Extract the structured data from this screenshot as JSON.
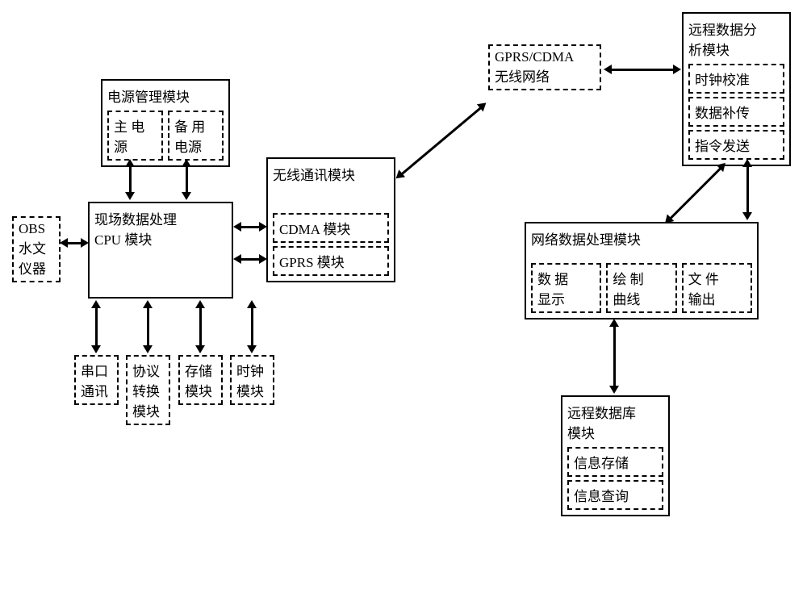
{
  "obs": {
    "l1": "OBS",
    "l2": "水文",
    "l3": "仪器"
  },
  "power": {
    "title": "电源管理模块",
    "main": {
      "l1": "主 电",
      "l2": "源"
    },
    "backup": {
      "l1": "备 用",
      "l2": "电源"
    }
  },
  "cpu": {
    "l1": "现场数据处理",
    "l2": "CPU 模块"
  },
  "wireless": {
    "title": "无线通讯模块",
    "cdma": "CDMA 模块",
    "gprs": "GPRS 模块"
  },
  "bottom": {
    "serial": {
      "l1": "串口",
      "l2": "通讯"
    },
    "protocol": {
      "l1": "协议",
      "l2": "转换",
      "l3": "模块"
    },
    "storage": {
      "l1": "存储",
      "l2": "模块"
    },
    "clock": {
      "l1": "时钟",
      "l2": "模块"
    }
  },
  "network": {
    "l1": "GPRS/CDMA",
    "l2": "无线网络"
  },
  "remote_analysis": {
    "title": "远程数据分",
    "title2": "析模块",
    "clock": "时钟校准",
    "retrans": "数据补传",
    "cmd": "指令发送"
  },
  "net_proc": {
    "title": "网络数据处理模块",
    "display": {
      "l1": "数  据",
      "l2": "显示"
    },
    "curve": {
      "l1": "绘  制",
      "l2": "曲线"
    },
    "file": {
      "l1": "文  件",
      "l2": "输出"
    }
  },
  "db": {
    "title": "远程数据库",
    "title2": "模块",
    "store": "信息存储",
    "query": "信息查询"
  }
}
